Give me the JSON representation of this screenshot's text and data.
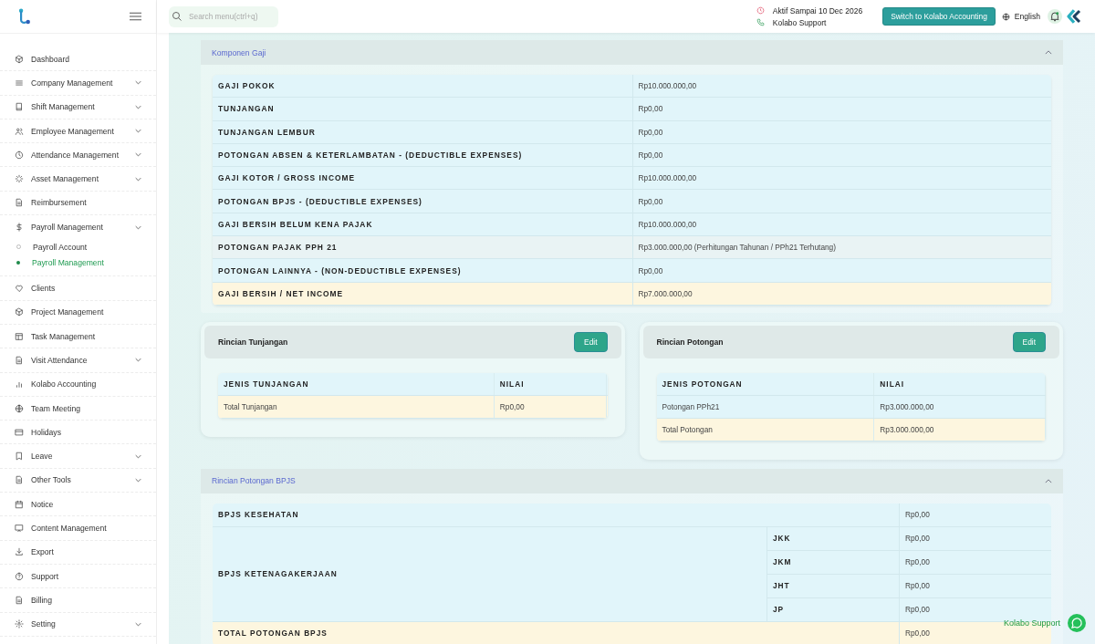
{
  "header": {
    "search": {
      "placeholder": "Search menu(ctrl+q)"
    },
    "subscription": "Aktif Sampai 10 Dec 2026",
    "support": "Kolabo Support",
    "switch_button": "Switch to Kolabo Accounting",
    "language": "English",
    "notification_dot": true
  },
  "sidebar": {
    "items": [
      {
        "label": "Dashboard",
        "has_submenu": false
      },
      {
        "label": "Company Management",
        "has_submenu": true
      },
      {
        "label": "Shift Management",
        "has_submenu": true
      },
      {
        "label": "Employee Management",
        "has_submenu": true
      },
      {
        "label": "Attendance Management",
        "has_submenu": true
      },
      {
        "label": "Asset Management",
        "has_submenu": true
      },
      {
        "label": "Reimbursement",
        "has_submenu": false
      },
      {
        "label": "Payroll Management",
        "has_submenu": true,
        "children": [
          {
            "label": "Payroll Account",
            "selected": false
          },
          {
            "label": "Payroll Management",
            "selected": true
          }
        ]
      },
      {
        "label": "Clients",
        "has_submenu": false
      },
      {
        "label": "Project Management",
        "has_submenu": false
      },
      {
        "label": "Task Management",
        "has_submenu": false
      },
      {
        "label": "Visit Attendance",
        "has_submenu": true
      },
      {
        "label": "Kolabo Accounting",
        "has_submenu": false
      },
      {
        "label": "Team Meeting",
        "has_submenu": false
      },
      {
        "label": "Holidays",
        "has_submenu": false
      },
      {
        "label": "Leave",
        "has_submenu": true
      },
      {
        "label": "Other Tools",
        "has_submenu": true
      },
      {
        "label": "Notice",
        "has_submenu": false
      },
      {
        "label": "Content Management",
        "has_submenu": false
      },
      {
        "label": "Export",
        "has_submenu": false
      },
      {
        "label": "Support",
        "has_submenu": false
      },
      {
        "label": "Billing",
        "has_submenu": false
      },
      {
        "label": "Setting",
        "has_submenu": true
      }
    ]
  },
  "komponen_gaji": {
    "title": "Komponen Gaji",
    "expanded": true,
    "rows": [
      {
        "label": "GAJI POKOK",
        "value": "Rp10.000.000,00",
        "kind": "normal"
      },
      {
        "label": "TUNJANGAN",
        "value": "Rp0,00",
        "kind": "normal"
      },
      {
        "label": "TUNJANGAN LEMBUR",
        "value": "Rp0,00",
        "kind": "normal"
      },
      {
        "label": "POTONGAN ABSEN & KETERLAMBATAN - (DEDUCTIBLE EXPENSES)",
        "value": "Rp0,00",
        "kind": "normal"
      },
      {
        "label": "GAJI KOTOR / GROSS INCOME",
        "value": "Rp10.000.000,00",
        "kind": "normal"
      },
      {
        "label": "POTONGAN BPJS - (DEDUCTIBLE EXPENSES)",
        "value": "Rp0,00",
        "kind": "normal"
      },
      {
        "label": "GAJI BERSIH BELUM KENA PAJAK",
        "value": "Rp10.000.000,00",
        "kind": "normal"
      },
      {
        "label": "POTONGAN PAJAK PPH 21",
        "value": "Rp3.000.000,00 (Perhitungan Tahunan / PPh21 Terhutang)",
        "kind": "hover"
      },
      {
        "label": "POTONGAN LAINNYA - (NON-DEDUCTIBLE EXPENSES)",
        "value": "Rp0,00",
        "kind": "normal"
      },
      {
        "label": "GAJI BERSIH / NET INCOME",
        "value": "Rp7.000.000,00",
        "kind": "total"
      }
    ]
  },
  "detail_cards": [
    {
      "title": "Rincian Tunjangan",
      "edit_button": "Edit",
      "columns": [
        "JENIS TUNJANGAN",
        "NILAI"
      ],
      "rows": [
        {
          "cells": [
            "Total Tunjangan",
            "Rp0,00"
          ],
          "kind": "total"
        }
      ]
    },
    {
      "title": "Rincian Potongan",
      "edit_button": "Edit",
      "columns": [
        "JENIS POTONGAN",
        "NILAI"
      ],
      "rows": [
        {
          "cells": [
            "Potongan PPh21",
            "Rp3.000.000,00"
          ],
          "kind": "normal"
        },
        {
          "cells": [
            "Total Potongan",
            "Rp3.000.000,00"
          ],
          "kind": "total"
        }
      ]
    }
  ],
  "bpjs": {
    "title": "Rincian Potongan BPJS",
    "expanded": true,
    "rows": [
      {
        "label": "BPJS KESEHATAN",
        "value": "Rp0,00",
        "kind": "normal"
      },
      {
        "label": "BPJS KETENAGAKERJAAN",
        "kind": "group",
        "parts": [
          {
            "label": "JKK",
            "value": "Rp0,00"
          },
          {
            "label": "JKM",
            "value": "Rp0,00"
          },
          {
            "label": "JHT",
            "value": "Rp0,00"
          },
          {
            "label": "JP",
            "value": "Rp0,00"
          }
        ]
      },
      {
        "label": "TOTAL POTONGAN BPJS",
        "value": "Rp0,00",
        "kind": "total"
      }
    ]
  },
  "chat_widget": {
    "label": "Kolabo Support"
  }
}
